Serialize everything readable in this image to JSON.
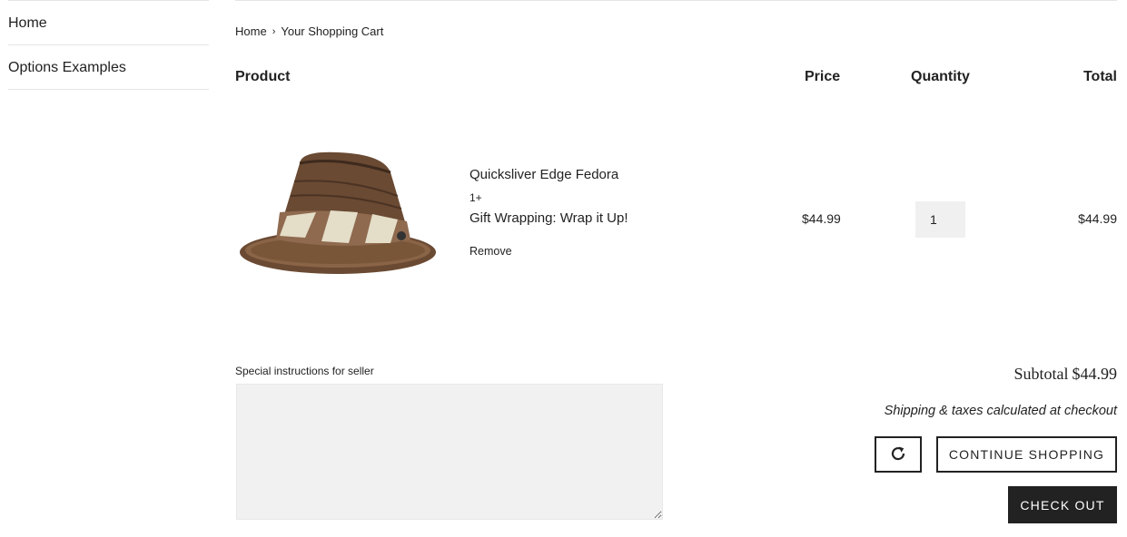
{
  "sidebar": {
    "items": [
      {
        "label": "Home"
      },
      {
        "label": "Options Examples"
      }
    ]
  },
  "breadcrumb": {
    "home": "Home",
    "separator": "›",
    "current": "Your Shopping Cart"
  },
  "cart_table": {
    "headers": {
      "product": "Product",
      "price": "Price",
      "quantity": "Quantity",
      "total": "Total"
    },
    "items": [
      {
        "title": "Quicksliver Edge Fedora",
        "variant": "1+",
        "option": "Gift Wrapping: Wrap it Up!",
        "remove_label": "Remove",
        "price": "$44.99",
        "quantity": "1",
        "total": "$44.99",
        "image_icon": "fedora-hat-image"
      }
    ]
  },
  "notes": {
    "label": "Special instructions for seller",
    "value": ""
  },
  "summary": {
    "subtotal_label": "Subtotal",
    "subtotal_value": "$44.99",
    "shipping_note": "Shipping & taxes calculated at checkout"
  },
  "actions": {
    "refresh_icon": "refresh-icon",
    "continue_label": "CONTINUE SHOPPING",
    "checkout_label": "CHECK OUT"
  },
  "colors": {
    "text": "#222222",
    "rule": "#e5e5e5",
    "input_bg": "#f0f0f0",
    "checkout_bg": "#222222"
  }
}
